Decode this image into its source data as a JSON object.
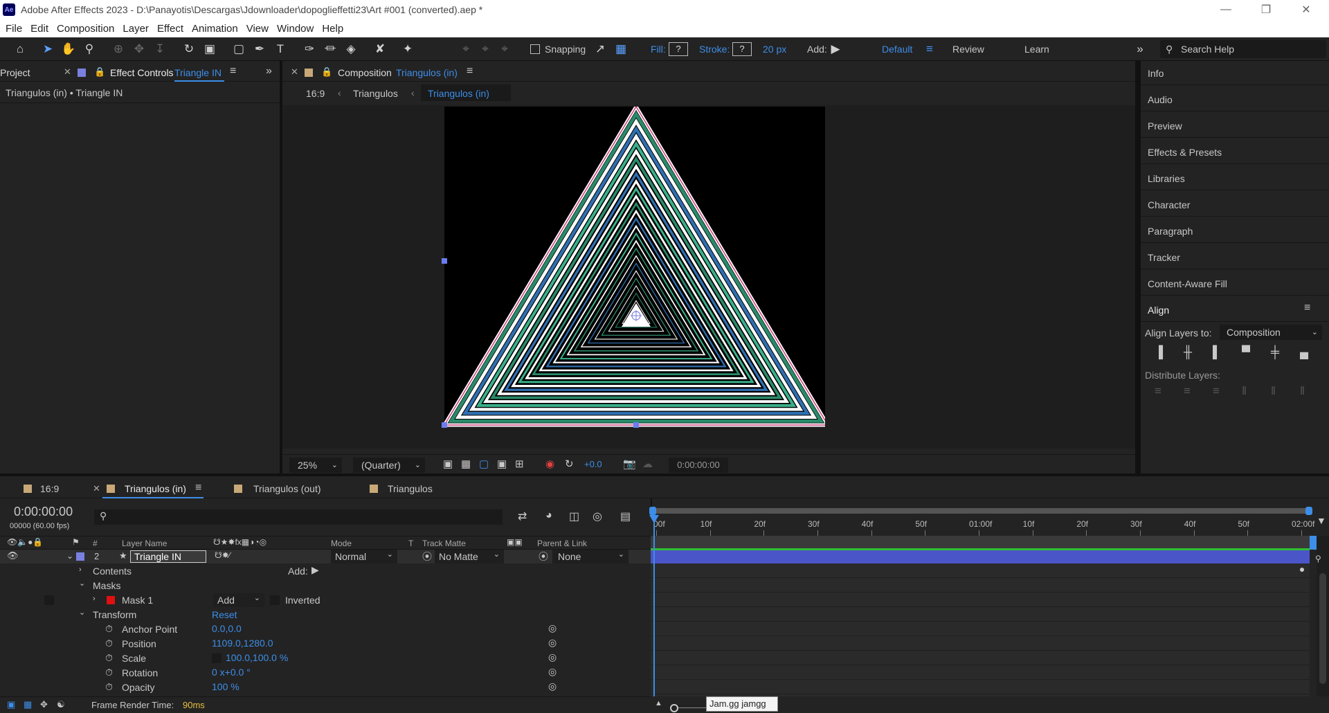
{
  "window": {
    "app_icon": "Ae",
    "title": "Adobe After Effects 2023 - D:\\Panayotis\\Descargas\\Jdownloader\\dopoglieffetti23\\Art #001 (converted).aep *",
    "controls": [
      "minimize-icon",
      "restore-icon",
      "close-icon"
    ]
  },
  "menu": [
    "File",
    "Edit",
    "Composition",
    "Layer",
    "Effect",
    "Animation",
    "View",
    "Window",
    "Help"
  ],
  "toolbar": {
    "snapping_label": "Snapping",
    "fill_label": "Fill:",
    "fill_value": "?",
    "stroke_label": "Stroke:",
    "stroke_value": "?",
    "stroke_width": "20 px",
    "add_label": "Add:",
    "workspaces": [
      "Default",
      "Review",
      "Learn"
    ],
    "search_placeholder": "Search Help"
  },
  "left_panel": {
    "project_tab": "Project",
    "effect_controls_tab": "Effect Controls",
    "effect_controls_layer": "Triangle IN",
    "breadcrumb": "Triangulos (in) • Triangle IN"
  },
  "comp_panel": {
    "tab_label": "Composition",
    "tab_comp": "Triangulos (in)",
    "flow": [
      "16:9",
      "Triangulos",
      "Triangulos (in)"
    ],
    "zoom": "25%",
    "resolution": "(Quarter)",
    "exposure": "+0.0",
    "timecode": "0:00:00:00"
  },
  "right_panel": {
    "items": [
      "Info",
      "Audio",
      "Preview",
      "Effects & Presets",
      "Libraries",
      "Character",
      "Paragraph",
      "Tracker",
      "Content-Aware Fill"
    ],
    "align_title": "Align",
    "align_layers_to_label": "Align Layers to:",
    "align_layers_to_value": "Composition",
    "distribute_label": "Distribute Layers:"
  },
  "timeline": {
    "tabs": [
      "16:9",
      "Triangulos (in)",
      "Triangulos (out)",
      "Triangulos"
    ],
    "timecode": "0:00:00:00",
    "timecode_sub": "00000 (60.00 fps)",
    "columns": {
      "layer_name": "Layer Name",
      "num": "#",
      "mode": "Mode",
      "t": "T",
      "track_matte": "Track Matte",
      "parent": "Parent & Link"
    },
    "layer": {
      "index": "2",
      "name": "Triangle IN",
      "mode": "Normal",
      "matte": "No Matte",
      "parent": "None"
    },
    "contents_label": "Contents",
    "add_label": "Add:",
    "masks_label": "Masks",
    "mask1_label": "Mask 1",
    "mask1_mode": "Add",
    "inverted_label": "Inverted",
    "transform_label": "Transform",
    "reset_label": "Reset",
    "properties": [
      {
        "name": "Anchor Point",
        "value": "0.0,0.0"
      },
      {
        "name": "Position",
        "value": "1109.0,1280.0"
      },
      {
        "name": "Scale",
        "value": "100.0,100.0 %"
      },
      {
        "name": "Rotation",
        "value": "0 x+0.0 °"
      },
      {
        "name": "Opacity",
        "value": "100 %"
      }
    ],
    "ruler": [
      "00f",
      "10f",
      "20f",
      "30f",
      "40f",
      "50f",
      "01:00f",
      "10f",
      "20f",
      "30f",
      "40f",
      "50f",
      "02:00f"
    ],
    "render_time_label": "Frame Render Time:",
    "render_time_value": "90ms",
    "tooltip": "Jam.gg jamgg"
  },
  "colors": {
    "accent": "#3d8ee8",
    "layer_label": "#7a80e0",
    "mask_color": "#e01010",
    "layer_bar": "#4a55c8"
  }
}
